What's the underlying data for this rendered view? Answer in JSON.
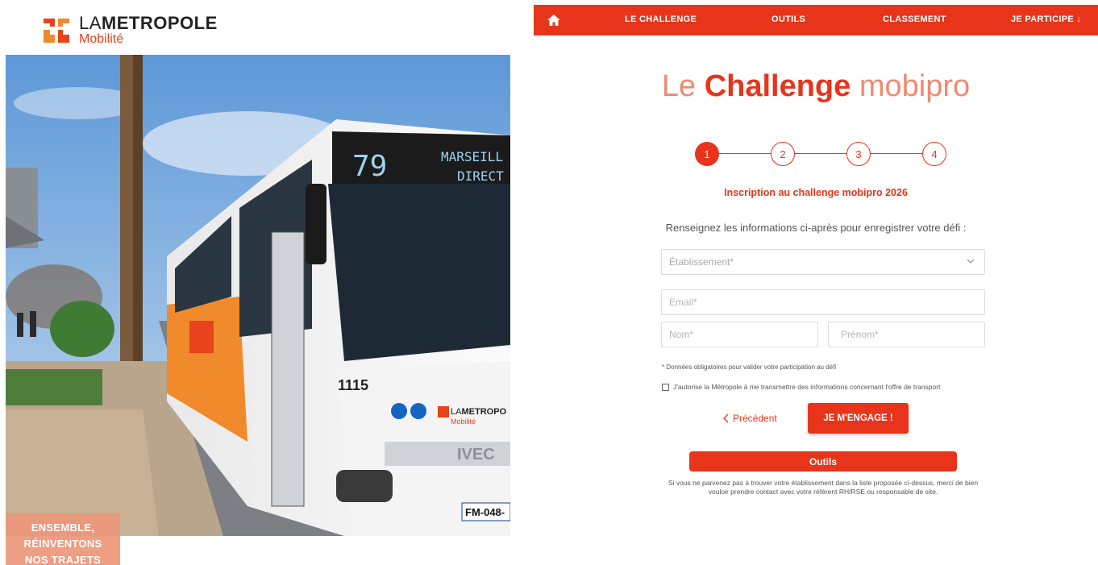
{
  "brand": {
    "line1_la": "LA",
    "line1_metropole": "METROPOLE",
    "line2": "Mobilité",
    "accent": "#e8341a"
  },
  "photo": {
    "bus_line": "79",
    "bus_destination_1": "MARSEILL",
    "bus_destination_2": "DIRECT",
    "bus_number": "1115",
    "bus_logo_la": "LA",
    "bus_logo_metropole": "METROPO",
    "bus_logo_mobilite": "Mobilité",
    "bus_brand": "IVEC",
    "plate": "FM-048-"
  },
  "slogan": {
    "line1": "ENSEMBLE,",
    "line2": "RÉINVENTONS",
    "line3": "NOS TRAJETS"
  },
  "nav": {
    "home_icon": "home-icon",
    "items": [
      "LE CHALLENGE",
      "OUTILS",
      "CLASSEMENT",
      "JE PARTICIPE"
    ],
    "participe_arrow": "↓"
  },
  "page": {
    "title_le": "Le",
    "title_challenge": "Challenge",
    "title_mobipro": "mobipro",
    "steps": [
      "1",
      "2",
      "3",
      "4"
    ],
    "active_step": 1,
    "subtitle": "Inscription au challenge mobipro 2026",
    "intro": "Renseignez les informations ci-après pour enregistrer votre défi :"
  },
  "form": {
    "etablissement_placeholder": "Établissement*",
    "email_placeholder": "Email*",
    "nom_placeholder": "Nom*",
    "prenom_placeholder": "Prénom*",
    "required_note": "* Données obligatoires pour valider votre participation au défi",
    "consent_label": "J'autorise la Métropole à me transmettre des informations concernant l'offre de transport",
    "consent_checked": false,
    "prev_label": "Précédent",
    "submit_label": "JE M'ENGAGE !",
    "outils_label": "Outils",
    "help_text": "Si vous ne parvenez pas à trouver votre établissement dans la liste proposée ci-dessus, merci de bien vouloir prendre contact avec votre référent RH/RSE ou responsable de site."
  }
}
